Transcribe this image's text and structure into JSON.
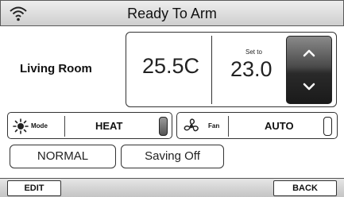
{
  "header": {
    "title": "Ready To Arm",
    "wifi_icon": "wifi-icon"
  },
  "thermostat": {
    "room": "Living Room",
    "current_temp": "25.5C",
    "setpoint_label": "Set to",
    "setpoint_value": "23.0",
    "up_icon": "chevron-up-icon",
    "down_icon": "chevron-down-icon"
  },
  "mode": {
    "icon": "sun-heat-icon",
    "label": "Mode",
    "value": "HEAT"
  },
  "fan": {
    "icon": "fan-icon",
    "label": "Fan",
    "value": "AUTO"
  },
  "programs": {
    "normal_label": "NORMAL",
    "saving_label": "Saving Off"
  },
  "footer": {
    "edit_label": "EDIT",
    "back_label": "BACK"
  }
}
